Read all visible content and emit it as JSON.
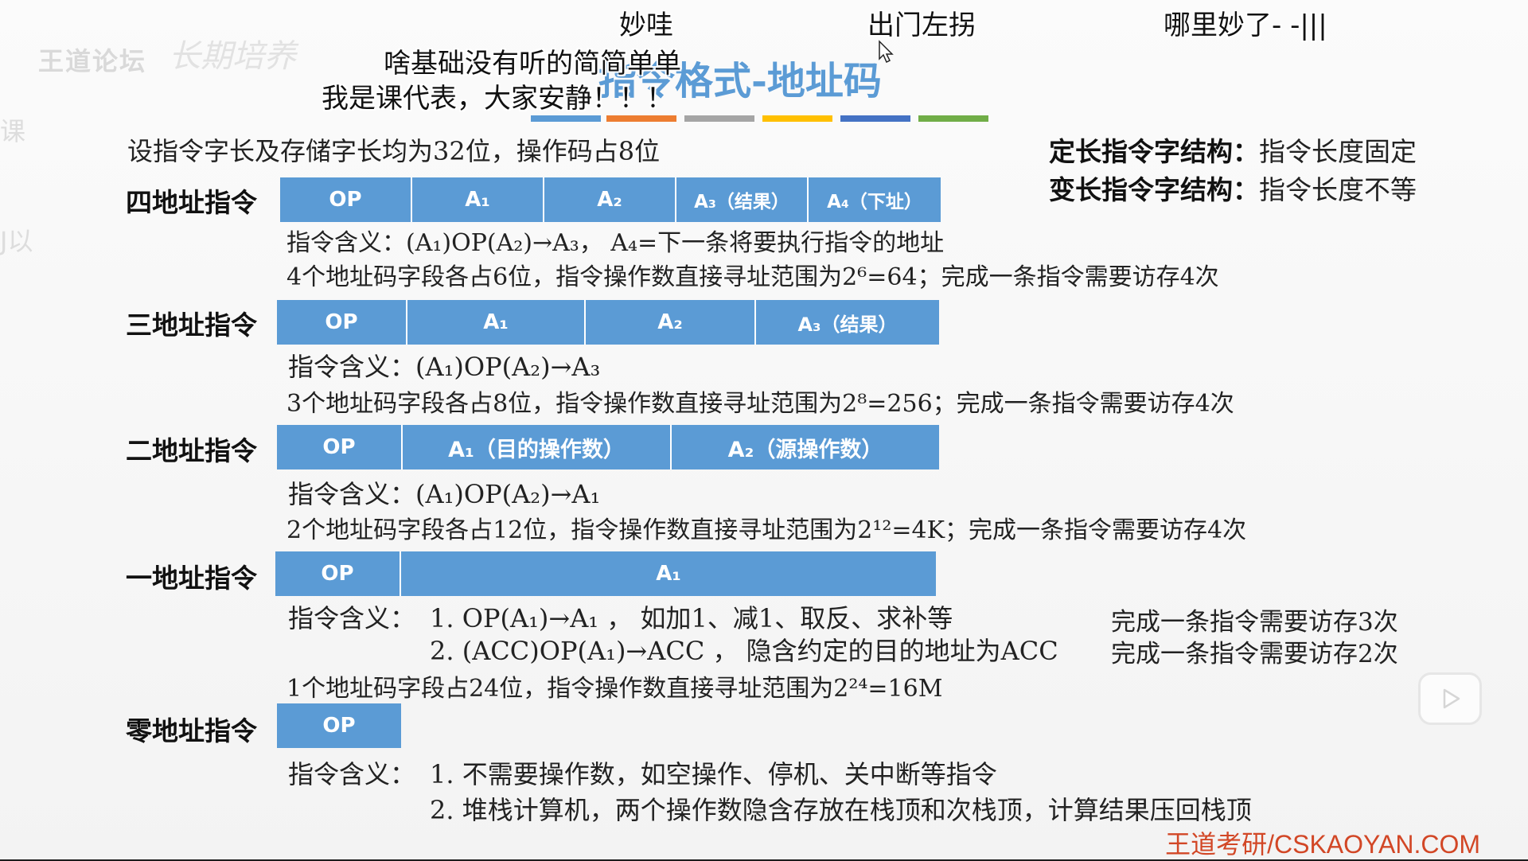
{
  "slide": {
    "logo": "王道论坛",
    "logo_scribble": "长期培养",
    "title": "指令格式-地址码",
    "color_bars": [
      "#5b9bd5",
      "#ed7d31",
      "#a5a5a5",
      "#ffc000",
      "#4472c4",
      "#70ad47"
    ],
    "intro": "设指令字长及存储字长均为32位，操作码占8位",
    "right_notes": [
      {
        "label": "定长指令字结构：",
        "text": "指令长度固定"
      },
      {
        "label": "变长指令字结构：",
        "text": "指令长度不等"
      }
    ],
    "rows": [
      {
        "label": "四地址指令",
        "fields": [
          "OP",
          "A₁",
          "A₂",
          "A₃（结果）",
          "A₄（下址）"
        ],
        "meaning": "指令含义：(A₁)OP(A₂)→A₃， A₄=下一条将要执行指令的地址",
        "detail": "4个地址码字段各占6位，指令操作数直接寻址范围为2⁶=64；完成一条指令需要访存4次"
      },
      {
        "label": "三地址指令",
        "fields": [
          "OP",
          "A₁",
          "A₂",
          "A₃（结果）"
        ],
        "meaning": "指令含义：(A₁)OP(A₂)→A₃",
        "detail": "3个地址码字段各占8位，指令操作数直接寻址范围为2⁸=256；完成一条指令需要访存4次"
      },
      {
        "label": "二地址指令",
        "fields": [
          "OP",
          "A₁（目的操作数）",
          "A₂（源操作数）"
        ],
        "meaning": "指令含义：(A₁)OP(A₂)→A₁",
        "detail": "2个地址码字段各占12位，指令操作数直接寻址范围为2¹²=4K；完成一条指令需要访存4次"
      },
      {
        "label": "一地址指令",
        "fields": [
          "OP",
          "A₁"
        ],
        "meaning_prefix": "指令含义：",
        "meaning_1": "1. OP(A₁)→A₁ ， 如加1、减1、取反、求补等",
        "meaning_2": "2. (ACC)OP(A₁)→ACC ， 隐含约定的目的地址为ACC",
        "note_1": "完成一条指令需要访存3次",
        "note_2": "完成一条指令需要访存2次",
        "detail": "1个地址码字段占24位，指令操作数直接寻址范围为2²⁴=16M"
      },
      {
        "label": "零地址指令",
        "fields": [
          "OP"
        ],
        "meaning_prefix": "指令含义：",
        "meaning_1": "1. 不需要操作数，如空操作、停机、关中断等指令",
        "meaning_2": "2. 堆栈计算机，两个操作数隐含存放在栈顶和次栈顶，计算结果压回栈顶"
      }
    ],
    "footer": "王道考研/CSKAOYAN.COM"
  },
  "danmaku": [
    {
      "text": "妙哇"
    },
    {
      "text": "出门左拐"
    },
    {
      "text": "哪里妙了- -|||"
    },
    {
      "text": "啥基础没有听的简简单单"
    },
    {
      "text": "我是课代表，大家安静！！！"
    }
  ],
  "left_edge": [
    "课",
    "J以"
  ],
  "player": {
    "play_icon": "play-icon"
  }
}
